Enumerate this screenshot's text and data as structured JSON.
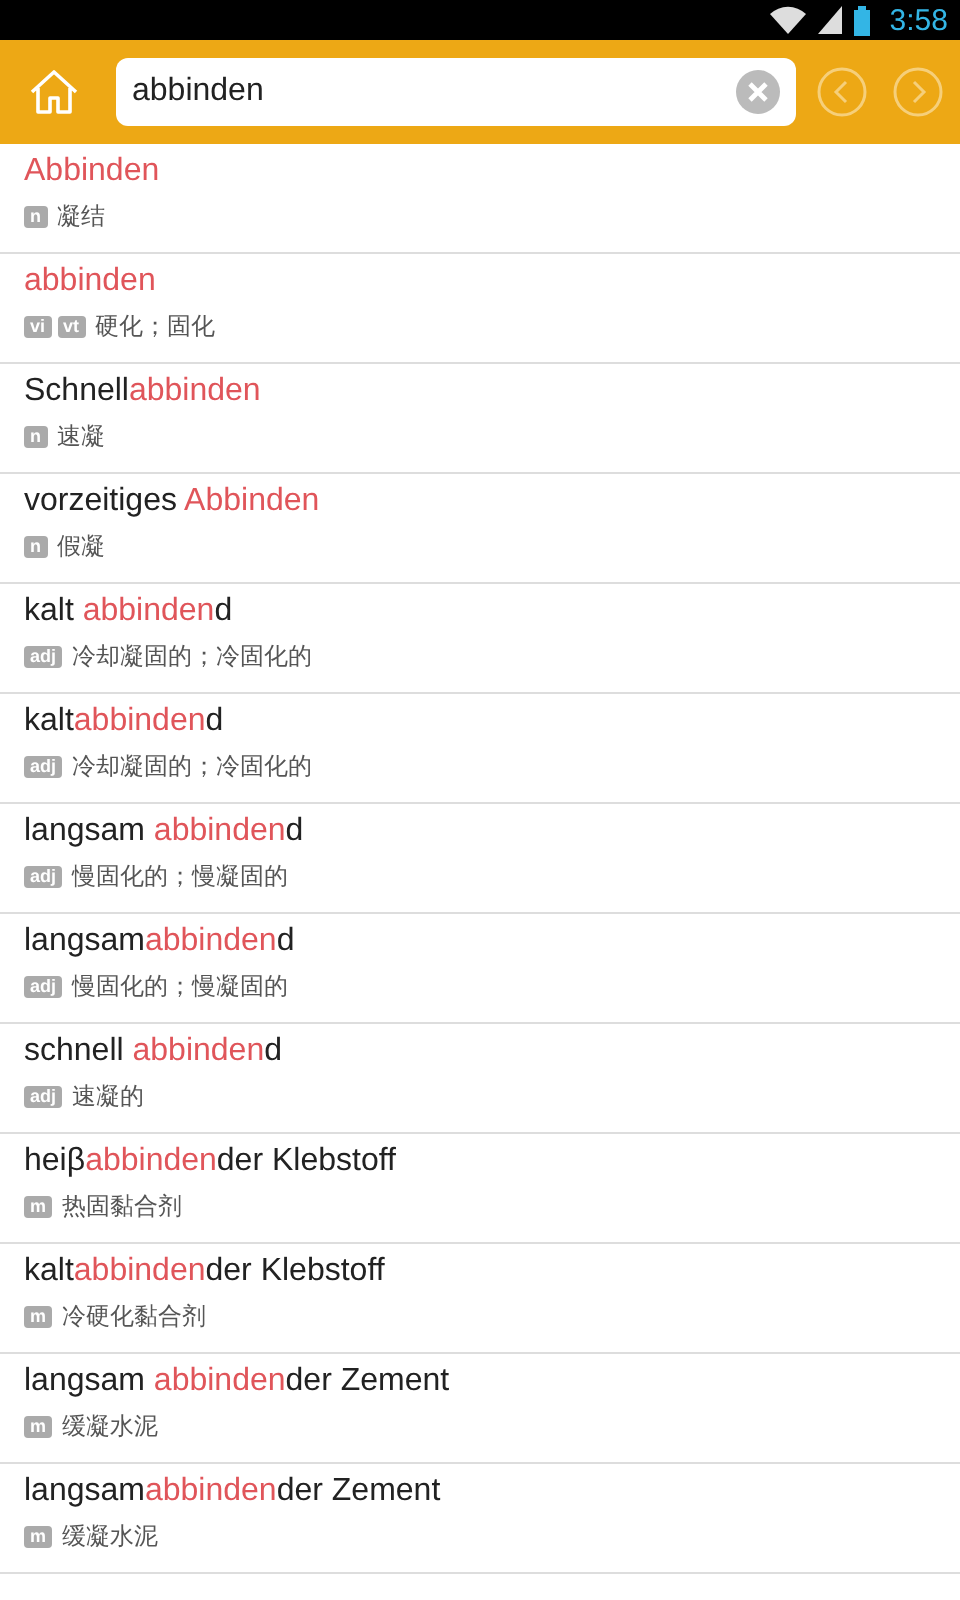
{
  "status_bar": {
    "time": "3:58"
  },
  "search": {
    "value": "abbinden"
  },
  "results": [
    {
      "headword": [
        {
          "text": "Abbinden",
          "highlight": true
        }
      ],
      "tags": [
        "n"
      ],
      "meaning": "凝结"
    },
    {
      "headword": [
        {
          "text": "abbinden",
          "highlight": true
        }
      ],
      "tags": [
        "vi",
        "vt"
      ],
      "meaning": "硬化；固化"
    },
    {
      "headword": [
        {
          "text": "Schnell",
          "highlight": false
        },
        {
          "text": "abbinden",
          "highlight": true
        }
      ],
      "tags": [
        "n"
      ],
      "meaning": "速凝"
    },
    {
      "headword": [
        {
          "text": "vorzeitiges ",
          "highlight": false
        },
        {
          "text": "Abbinden",
          "highlight": true
        }
      ],
      "tags": [
        "n"
      ],
      "meaning": "假凝"
    },
    {
      "headword": [
        {
          "text": "kalt ",
          "highlight": false
        },
        {
          "text": "abbinden",
          "highlight": true
        },
        {
          "text": "d",
          "highlight": false
        }
      ],
      "tags": [
        "adj"
      ],
      "meaning": "冷却凝固的；冷固化的"
    },
    {
      "headword": [
        {
          "text": "kalt",
          "highlight": false
        },
        {
          "text": "abbinden",
          "highlight": true
        },
        {
          "text": "d",
          "highlight": false
        }
      ],
      "tags": [
        "adj"
      ],
      "meaning": "冷却凝固的；冷固化的"
    },
    {
      "headword": [
        {
          "text": "langsam ",
          "highlight": false
        },
        {
          "text": "abbinden",
          "highlight": true
        },
        {
          "text": "d",
          "highlight": false
        }
      ],
      "tags": [
        "adj"
      ],
      "meaning": "慢固化的；慢凝固的"
    },
    {
      "headword": [
        {
          "text": "langsam",
          "highlight": false
        },
        {
          "text": "abbinden",
          "highlight": true
        },
        {
          "text": "d",
          "highlight": false
        }
      ],
      "tags": [
        "adj"
      ],
      "meaning": "慢固化的；慢凝固的"
    },
    {
      "headword": [
        {
          "text": "schnell ",
          "highlight": false
        },
        {
          "text": "abbinden",
          "highlight": true
        },
        {
          "text": "d",
          "highlight": false
        }
      ],
      "tags": [
        "adj"
      ],
      "meaning": "速凝的"
    },
    {
      "headword": [
        {
          "text": "heiβ",
          "highlight": false
        },
        {
          "text": "abbinden",
          "highlight": true
        },
        {
          "text": "der Klebstoff",
          "highlight": false
        }
      ],
      "tags": [
        "m"
      ],
      "meaning": "热固黏合剂"
    },
    {
      "headword": [
        {
          "text": "kalt",
          "highlight": false
        },
        {
          "text": "abbinden",
          "highlight": true
        },
        {
          "text": "der Klebstoff",
          "highlight": false
        }
      ],
      "tags": [
        "m"
      ],
      "meaning": "冷硬化黏合剂"
    },
    {
      "headword": [
        {
          "text": "langsam ",
          "highlight": false
        },
        {
          "text": "abbinden",
          "highlight": true
        },
        {
          "text": "der Zement",
          "highlight": false
        }
      ],
      "tags": [
        "m"
      ],
      "meaning": "缓凝水泥"
    },
    {
      "headword": [
        {
          "text": "langsam",
          "highlight": false
        },
        {
          "text": "abbinden",
          "highlight": true
        },
        {
          "text": "der Zement",
          "highlight": false
        }
      ],
      "tags": [
        "m"
      ],
      "meaning": "缓凝水泥"
    }
  ]
}
